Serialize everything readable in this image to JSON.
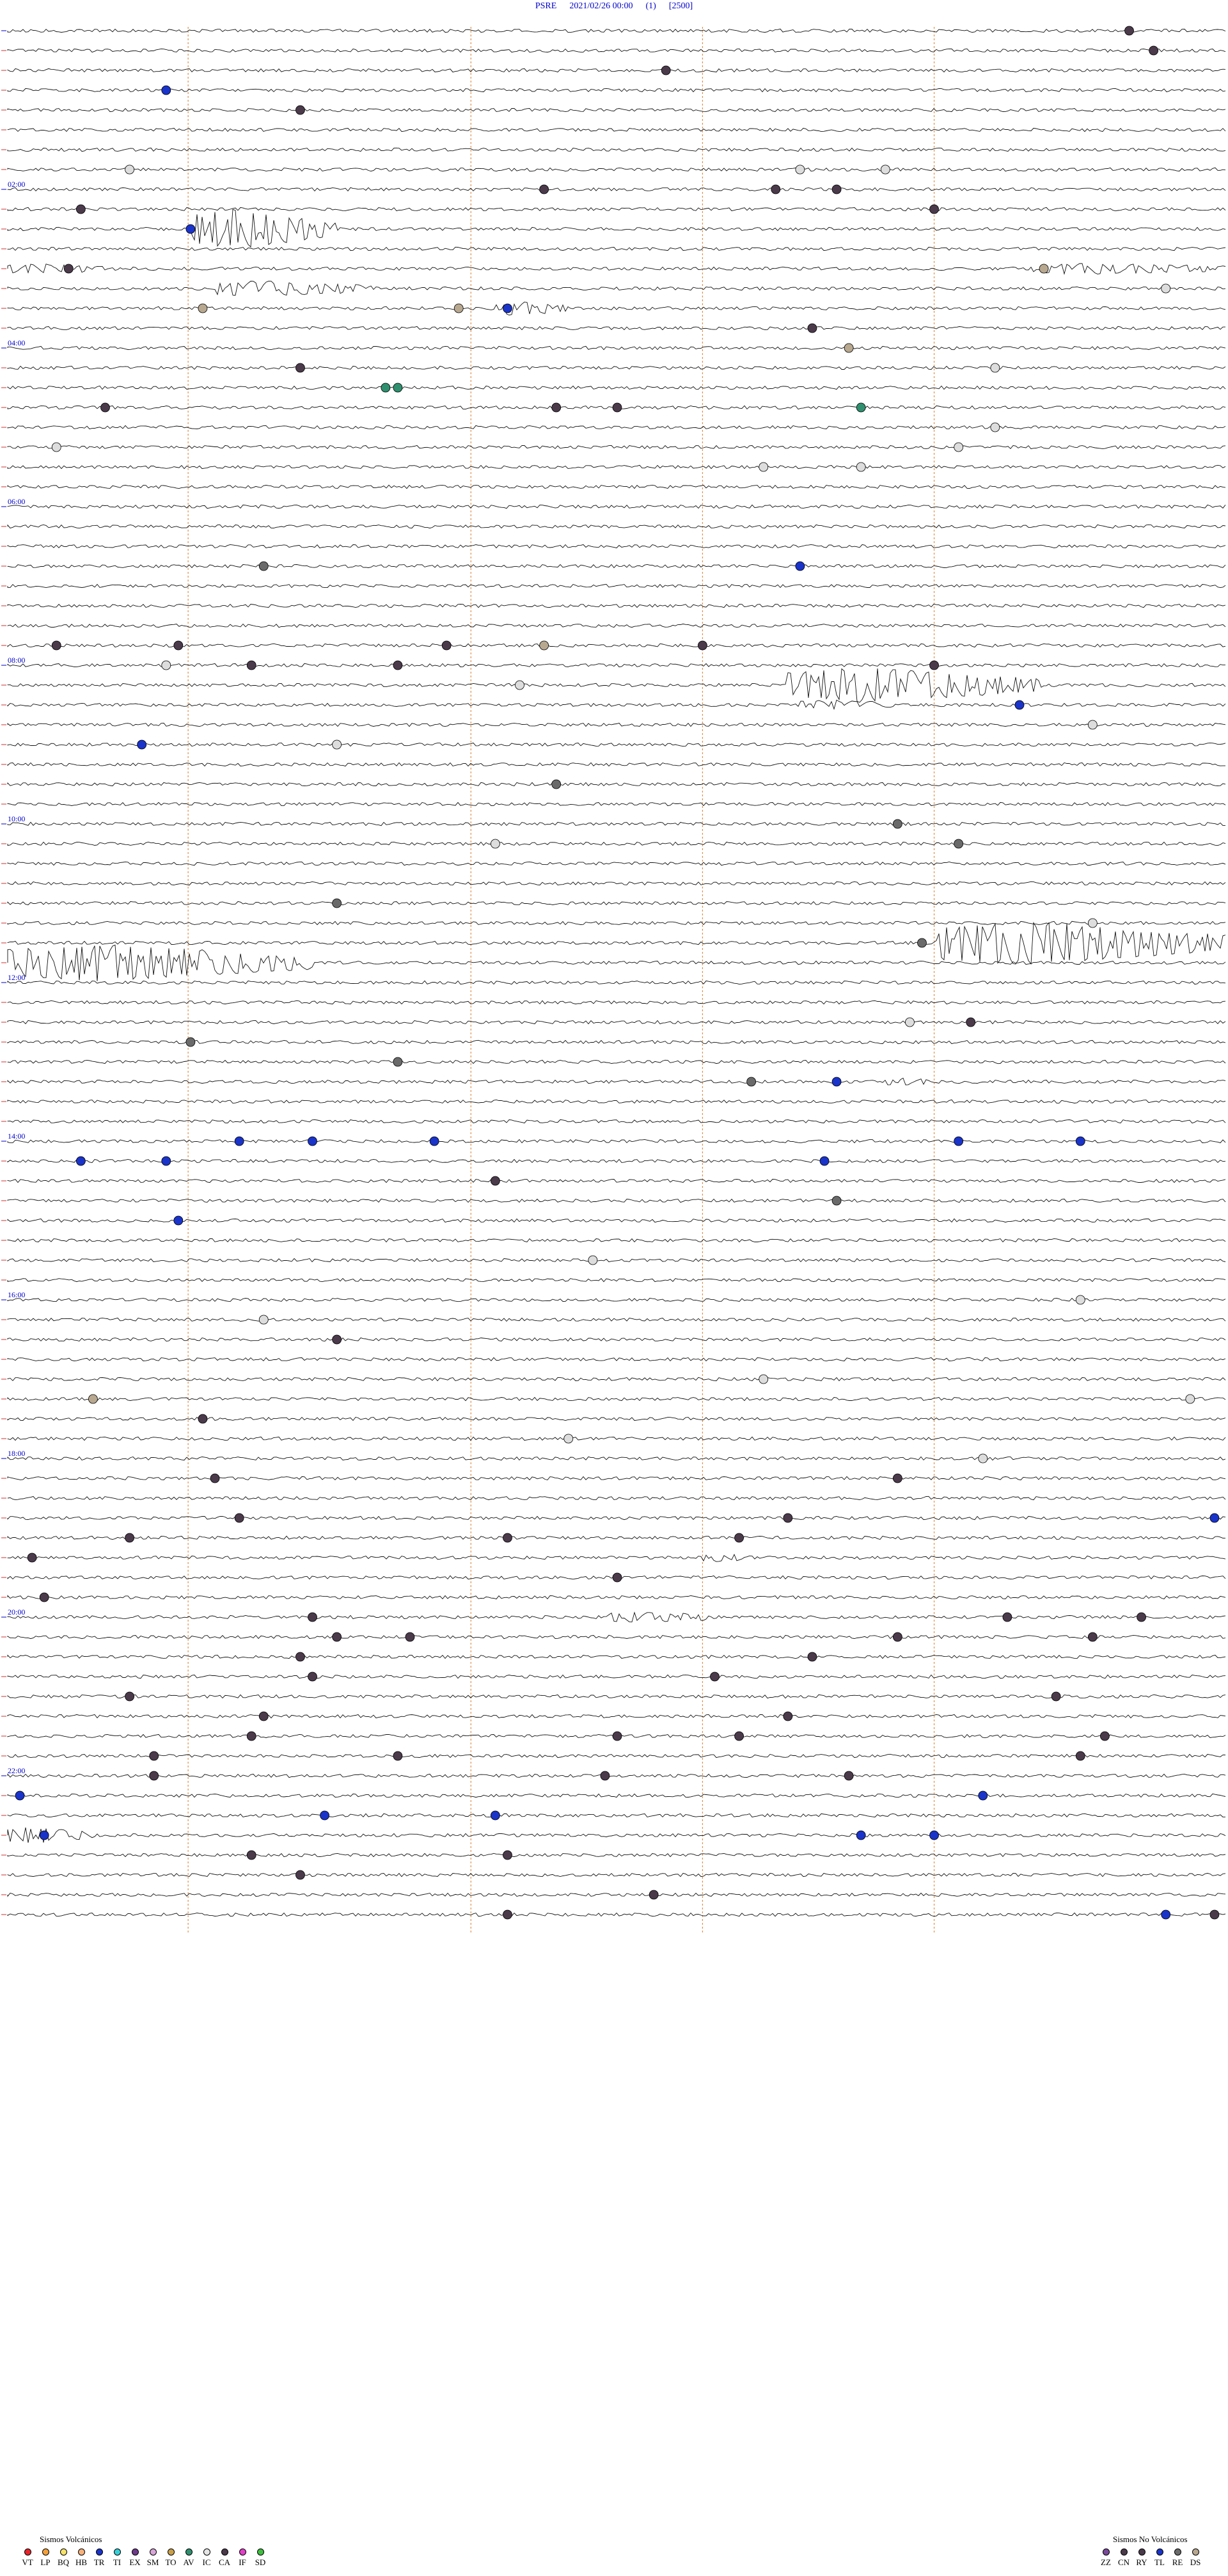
{
  "header": {
    "station": "PSRE",
    "datetime": "2021/02/26 00:00",
    "component": "(1)",
    "scale": "[2500]"
  },
  "legend": {
    "volcanic_title": "Sismos Volcánicos",
    "volcanic": [
      {
        "code": "VT",
        "color": "#e8232a"
      },
      {
        "code": "LP",
        "color": "#f2a13a"
      },
      {
        "code": "BQ",
        "color": "#f7e36b"
      },
      {
        "code": "HB",
        "color": "#f7b27a"
      },
      {
        "code": "TR",
        "color": "#1a33c9"
      },
      {
        "code": "TI",
        "color": "#36cfd8"
      },
      {
        "code": "EX",
        "color": "#6e3a8a"
      },
      {
        "code": "SM",
        "color": "#d8a6d8"
      },
      {
        "code": "TO",
        "color": "#c9a04a"
      },
      {
        "code": "AV",
        "color": "#2f8f6f"
      },
      {
        "code": "IC",
        "color": "#e6e6e6"
      },
      {
        "code": "CA",
        "color": "#4a3a4a"
      },
      {
        "code": "IF",
        "color": "#e23fc8"
      },
      {
        "code": "SD",
        "color": "#3fbf3f"
      }
    ],
    "nonvolcanic_title": "Sismos No Volcánicos",
    "nonvolcanic": [
      {
        "code": "ZZ",
        "color": "#7a4a9a"
      },
      {
        "code": "CN",
        "color": "#4a3a4a"
      },
      {
        "code": "RY",
        "color": "#4a3a4a"
      },
      {
        "code": "TL",
        "color": "#1a33c9"
      },
      {
        "code": "RE",
        "color": "#6a6a6a"
      },
      {
        "code": "DS",
        "color": "#b8a890"
      }
    ]
  },
  "chart_data": {
    "type": "helicorder",
    "traces": 96,
    "minutes_per_trace": 15,
    "hour_labels": [
      "02:00",
      "04:00",
      "06:00",
      "08:00",
      "10:00",
      "12:00",
      "14:00",
      "16:00",
      "18:00",
      "20:00",
      "22:00"
    ],
    "event_colors": {
      "CA": "#4a3a4a",
      "IC": "#dddddd",
      "TR": "#1a33c9",
      "AV": "#2f8f6f",
      "RE": "#6a6a6a",
      "DS": "#b8a890"
    },
    "events": [
      {
        "trace": 0,
        "t": 0.92,
        "type": "CA"
      },
      {
        "trace": 1,
        "t": 0.94,
        "type": "CA"
      },
      {
        "trace": 2,
        "t": 0.54,
        "type": "CA"
      },
      {
        "trace": 3,
        "t": 0.13,
        "type": "TR"
      },
      {
        "trace": 4,
        "t": 0.24,
        "type": "CA"
      },
      {
        "trace": 7,
        "t": 0.1,
        "type": "IC"
      },
      {
        "trace": 7,
        "t": 0.65,
        "type": "IC"
      },
      {
        "trace": 7,
        "t": 0.72,
        "type": "IC"
      },
      {
        "trace": 8,
        "t": 0.44,
        "type": "CA"
      },
      {
        "trace": 8,
        "t": 0.63,
        "type": "CA"
      },
      {
        "trace": 8,
        "t": 0.68,
        "type": "CA"
      },
      {
        "trace": 9,
        "t": 0.06,
        "type": "CA"
      },
      {
        "trace": 9,
        "t": 0.76,
        "type": "CA"
      },
      {
        "trace": 10,
        "t": 0.15,
        "type": "TR"
      },
      {
        "trace": 12,
        "t": 0.05,
        "type": "CA"
      },
      {
        "trace": 12,
        "t": 0.85,
        "type": "DS"
      },
      {
        "trace": 13,
        "t": 0.95,
        "type": "IC"
      },
      {
        "trace": 14,
        "t": 0.16,
        "type": "DS"
      },
      {
        "trace": 14,
        "t": 0.37,
        "type": "DS"
      },
      {
        "trace": 14,
        "t": 0.41,
        "type": "TR"
      },
      {
        "trace": 15,
        "t": 0.66,
        "type": "CA"
      },
      {
        "trace": 16,
        "t": 0.69,
        "type": "DS"
      },
      {
        "trace": 17,
        "t": 0.24,
        "type": "CA"
      },
      {
        "trace": 17,
        "t": 0.81,
        "type": "IC"
      },
      {
        "trace": 18,
        "t": 0.31,
        "type": "AV"
      },
      {
        "trace": 18,
        "t": 0.32,
        "type": "AV"
      },
      {
        "trace": 19,
        "t": 0.08,
        "type": "CA"
      },
      {
        "trace": 19,
        "t": 0.45,
        "type": "CA"
      },
      {
        "trace": 19,
        "t": 0.5,
        "type": "CA"
      },
      {
        "trace": 19,
        "t": 0.7,
        "type": "AV"
      },
      {
        "trace": 20,
        "t": 0.81,
        "type": "IC"
      },
      {
        "trace": 21,
        "t": 0.04,
        "type": "IC"
      },
      {
        "trace": 21,
        "t": 0.78,
        "type": "IC"
      },
      {
        "trace": 22,
        "t": 0.62,
        "type": "IC"
      },
      {
        "trace": 22,
        "t": 0.7,
        "type": "IC"
      },
      {
        "trace": 27,
        "t": 0.21,
        "type": "RE"
      },
      {
        "trace": 27,
        "t": 0.65,
        "type": "TR"
      },
      {
        "trace": 31,
        "t": 0.04,
        "type": "CA"
      },
      {
        "trace": 31,
        "t": 0.14,
        "type": "CA"
      },
      {
        "trace": 31,
        "t": 0.36,
        "type": "CA"
      },
      {
        "trace": 31,
        "t": 0.44,
        "type": "DS"
      },
      {
        "trace": 31,
        "t": 0.57,
        "type": "CA"
      },
      {
        "trace": 32,
        "t": 0.13,
        "type": "IC"
      },
      {
        "trace": 32,
        "t": 0.2,
        "type": "CA"
      },
      {
        "trace": 32,
        "t": 0.32,
        "type": "CA"
      },
      {
        "trace": 32,
        "t": 0.76,
        "type": "CA"
      },
      {
        "trace": 33,
        "t": 0.42,
        "type": "IC"
      },
      {
        "trace": 34,
        "t": 0.83,
        "type": "TR"
      },
      {
        "trace": 35,
        "t": 0.89,
        "type": "IC"
      },
      {
        "trace": 36,
        "t": 0.11,
        "type": "TR"
      },
      {
        "trace": 36,
        "t": 0.27,
        "type": "IC"
      },
      {
        "trace": 38,
        "t": 0.45,
        "type": "RE"
      },
      {
        "trace": 40,
        "t": 0.73,
        "type": "RE"
      },
      {
        "trace": 41,
        "t": 0.78,
        "type": "RE"
      },
      {
        "trace": 41,
        "t": 0.4,
        "type": "IC"
      },
      {
        "trace": 44,
        "t": 0.27,
        "type": "RE"
      },
      {
        "trace": 45,
        "t": 0.89,
        "type": "IC"
      },
      {
        "trace": 46,
        "t": 0.75,
        "type": "RE"
      },
      {
        "trace": 50,
        "t": 0.79,
        "type": "CA"
      },
      {
        "trace": 50,
        "t": 0.74,
        "type": "IC"
      },
      {
        "trace": 51,
        "t": 0.15,
        "type": "RE"
      },
      {
        "trace": 52,
        "t": 0.32,
        "type": "RE"
      },
      {
        "trace": 53,
        "t": 0.68,
        "type": "TR"
      },
      {
        "trace": 53,
        "t": 0.61,
        "type": "RE"
      },
      {
        "trace": 56,
        "t": 0.19,
        "type": "TR"
      },
      {
        "trace": 56,
        "t": 0.25,
        "type": "TR"
      },
      {
        "trace": 56,
        "t": 0.35,
        "type": "TR"
      },
      {
        "trace": 56,
        "t": 0.78,
        "type": "TR"
      },
      {
        "trace": 56,
        "t": 0.88,
        "type": "TR"
      },
      {
        "trace": 57,
        "t": 0.06,
        "type": "TR"
      },
      {
        "trace": 57,
        "t": 0.13,
        "type": "TR"
      },
      {
        "trace": 57,
        "t": 0.67,
        "type": "TR"
      },
      {
        "trace": 58,
        "t": 0.4,
        "type": "CA"
      },
      {
        "trace": 59,
        "t": 0.68,
        "type": "RE"
      },
      {
        "trace": 60,
        "t": 0.14,
        "type": "TR"
      },
      {
        "trace": 62,
        "t": 0.48,
        "type": "IC"
      },
      {
        "trace": 64,
        "t": 0.88,
        "type": "IC"
      },
      {
        "trace": 65,
        "t": 0.21,
        "type": "IC"
      },
      {
        "trace": 66,
        "t": 0.27,
        "type": "CA"
      },
      {
        "trace": 68,
        "t": 0.62,
        "type": "IC"
      },
      {
        "trace": 69,
        "t": 0.07,
        "type": "DS"
      },
      {
        "trace": 69,
        "t": 0.97,
        "type": "IC"
      },
      {
        "trace": 70,
        "t": 0.16,
        "type": "CA"
      },
      {
        "trace": 71,
        "t": 0.46,
        "type": "IC"
      },
      {
        "trace": 72,
        "t": 0.8,
        "type": "IC"
      },
      {
        "trace": 73,
        "t": 0.17,
        "type": "CA"
      },
      {
        "trace": 73,
        "t": 0.73,
        "type": "CA"
      },
      {
        "trace": 75,
        "t": 0.19,
        "type": "CA"
      },
      {
        "trace": 75,
        "t": 0.64,
        "type": "CA"
      },
      {
        "trace": 75,
        "t": 0.99,
        "type": "TR"
      },
      {
        "trace": 76,
        "t": 0.1,
        "type": "CA"
      },
      {
        "trace": 76,
        "t": 0.41,
        "type": "CA"
      },
      {
        "trace": 76,
        "t": 0.6,
        "type": "CA"
      },
      {
        "trace": 77,
        "t": 0.02,
        "type": "CA"
      },
      {
        "trace": 78,
        "t": 0.5,
        "type": "CA"
      },
      {
        "trace": 79,
        "t": 0.03,
        "type": "CA"
      },
      {
        "trace": 80,
        "t": 0.25,
        "type": "CA"
      },
      {
        "trace": 80,
        "t": 0.82,
        "type": "CA"
      },
      {
        "trace": 80,
        "t": 0.93,
        "type": "CA"
      },
      {
        "trace": 81,
        "t": 0.27,
        "type": "CA"
      },
      {
        "trace": 81,
        "t": 0.33,
        "type": "CA"
      },
      {
        "trace": 81,
        "t": 0.73,
        "type": "CA"
      },
      {
        "trace": 81,
        "t": 0.89,
        "type": "CA"
      },
      {
        "trace": 82,
        "t": 0.24,
        "type": "CA"
      },
      {
        "trace": 82,
        "t": 0.66,
        "type": "CA"
      },
      {
        "trace": 83,
        "t": 0.25,
        "type": "CA"
      },
      {
        "trace": 83,
        "t": 0.58,
        "type": "CA"
      },
      {
        "trace": 84,
        "t": 0.1,
        "type": "CA"
      },
      {
        "trace": 84,
        "t": 0.86,
        "type": "CA"
      },
      {
        "trace": 85,
        "t": 0.21,
        "type": "CA"
      },
      {
        "trace": 85,
        "t": 0.64,
        "type": "CA"
      },
      {
        "trace": 86,
        "t": 0.2,
        "type": "CA"
      },
      {
        "trace": 86,
        "t": 0.5,
        "type": "CA"
      },
      {
        "trace": 86,
        "t": 0.6,
        "type": "CA"
      },
      {
        "trace": 86,
        "t": 0.9,
        "type": "CA"
      },
      {
        "trace": 87,
        "t": 0.12,
        "type": "CA"
      },
      {
        "trace": 87,
        "t": 0.32,
        "type": "CA"
      },
      {
        "trace": 87,
        "t": 0.88,
        "type": "CA"
      },
      {
        "trace": 88,
        "t": 0.12,
        "type": "CA"
      },
      {
        "trace": 88,
        "t": 0.49,
        "type": "CA"
      },
      {
        "trace": 88,
        "t": 0.69,
        "type": "CA"
      },
      {
        "trace": 89,
        "t": 0.01,
        "type": "TR"
      },
      {
        "trace": 89,
        "t": 0.8,
        "type": "TR"
      },
      {
        "trace": 90,
        "t": 0.26,
        "type": "TR"
      },
      {
        "trace": 90,
        "t": 0.4,
        "type": "TR"
      },
      {
        "trace": 91,
        "t": 0.03,
        "type": "TR"
      },
      {
        "trace": 91,
        "t": 0.7,
        "type": "TR"
      },
      {
        "trace": 91,
        "t": 0.76,
        "type": "TR"
      },
      {
        "trace": 92,
        "t": 0.2,
        "type": "CA"
      },
      {
        "trace": 92,
        "t": 0.41,
        "type": "CA"
      },
      {
        "trace": 93,
        "t": 0.24,
        "type": "CA"
      },
      {
        "trace": 94,
        "t": 0.53,
        "type": "CA"
      },
      {
        "trace": 95,
        "t": 0.41,
        "type": "CA"
      },
      {
        "trace": 95,
        "t": 0.95,
        "type": "TR"
      },
      {
        "trace": 95,
        "t": 0.99,
        "type": "CA"
      }
    ],
    "bursts": [
      {
        "trace": 10,
        "t0": 0.15,
        "t1": 0.27,
        "amp": 3.2
      },
      {
        "trace": 13,
        "t0": 0.17,
        "t1": 0.3,
        "amp": 1.1
      },
      {
        "trace": 12,
        "t0": 0.0,
        "t1": 0.08,
        "amp": 0.6
      },
      {
        "trace": 12,
        "t0": 0.84,
        "t1": 1.0,
        "amp": 0.7
      },
      {
        "trace": 14,
        "t0": 0.4,
        "t1": 0.46,
        "amp": 1.0
      },
      {
        "trace": 33,
        "t0": 0.64,
        "t1": 0.85,
        "amp": 2.8
      },
      {
        "trace": 34,
        "t0": 0.65,
        "t1": 0.73,
        "amp": 0.6
      },
      {
        "trace": 47,
        "t0": 0.0,
        "t1": 0.25,
        "amp": 3.0
      },
      {
        "trace": 46,
        "t0": 0.76,
        "t1": 1.0,
        "amp": 3.6
      },
      {
        "trace": 53,
        "t0": 0.72,
        "t1": 0.76,
        "amp": 0.4
      },
      {
        "trace": 77,
        "t0": 0.57,
        "t1": 0.61,
        "amp": 0.5
      },
      {
        "trace": 80,
        "t0": 0.49,
        "t1": 0.58,
        "amp": 0.7
      },
      {
        "trace": 91,
        "t0": 0.0,
        "t1": 0.07,
        "amp": 1.2
      }
    ],
    "x_gridlines": [
      0.2,
      0.4,
      0.6,
      0.8
    ]
  }
}
